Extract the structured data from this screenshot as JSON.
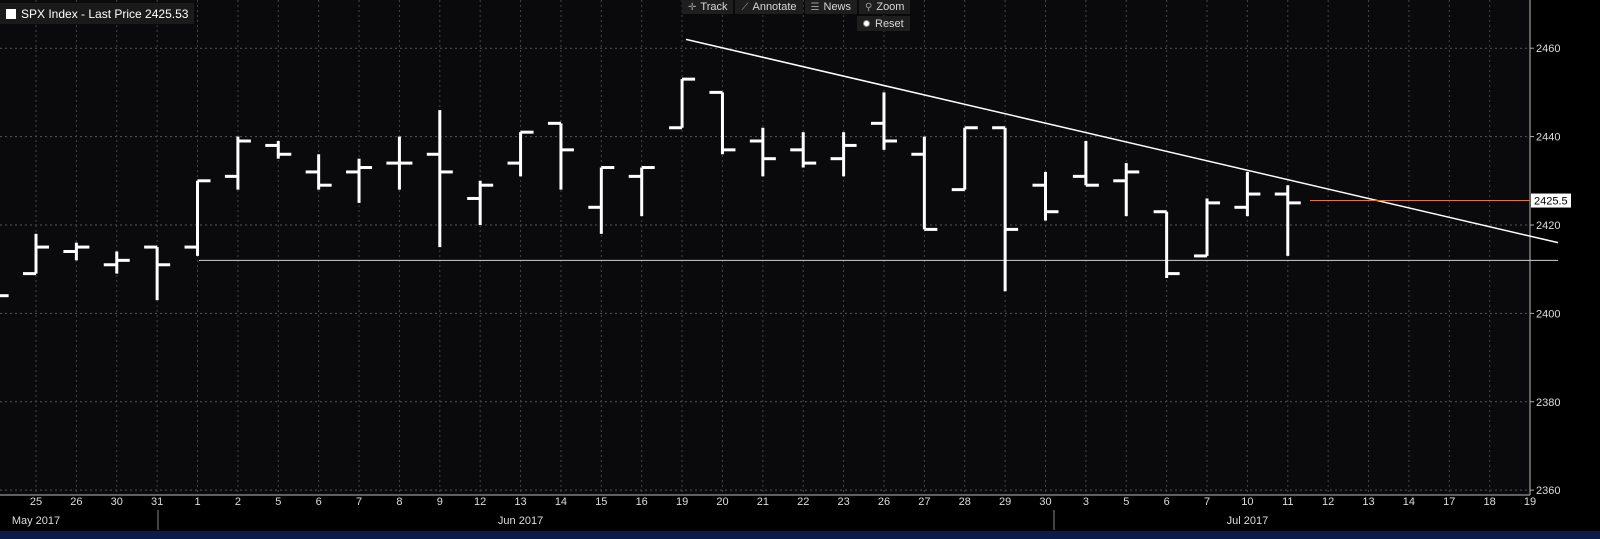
{
  "toolbar": {
    "track": "Track",
    "annotate": "Annotate",
    "news": "News",
    "zoom": "Zoom",
    "reset": "Reset"
  },
  "legend": {
    "text": "SPX Index - Last Price 2425.53"
  },
  "colors": {
    "background": "#000000",
    "bars": "#ffffff",
    "last_price_line": "#e07a2e",
    "trendline": "#ffffff"
  },
  "chart_data": {
    "type": "ohlc",
    "title": "SPX Index - Last Price 2425.53",
    "ylim": [
      2358,
      2470
    ],
    "y_ticks": [
      2360,
      2380,
      2400,
      2420,
      2440,
      2460
    ],
    "y_axis_position": "right",
    "grid": true,
    "last_price": 2425.53,
    "last_price_label": "2425.5",
    "x_tick_labels": [
      "25",
      "26",
      "30",
      "31",
      "1",
      "2",
      "5",
      "6",
      "7",
      "8",
      "9",
      "12",
      "13",
      "14",
      "15",
      "16",
      "19",
      "20",
      "21",
      "22",
      "23",
      "26",
      "27",
      "28",
      "29",
      "30",
      "3",
      "5",
      "6",
      "7",
      "10",
      "11",
      "12",
      "13",
      "14",
      "17",
      "18",
      "19"
    ],
    "month_labels": [
      {
        "label": "May 2017",
        "at": "25"
      },
      {
        "label": "Jun 2017",
        "at": "13"
      },
      {
        "label": "Jul 2017",
        "at": "10"
      }
    ],
    "bars": [
      {
        "date": "24",
        "open": 2404,
        "high": 2404,
        "low": 2404,
        "close": 2404
      },
      {
        "date": "25",
        "open": 2409,
        "high": 2418,
        "low": 2409,
        "close": 2415
      },
      {
        "date": "26",
        "open": 2414,
        "high": 2416,
        "low": 2412,
        "close": 2415
      },
      {
        "date": "30",
        "open": 2411,
        "high": 2414,
        "low": 2409,
        "close": 2412
      },
      {
        "date": "31",
        "open": 2415,
        "high": 2415,
        "low": 2403,
        "close": 2411
      },
      {
        "date": "1",
        "open": 2415,
        "high": 2430,
        "low": 2413,
        "close": 2430
      },
      {
        "date": "2",
        "open": 2431,
        "high": 2440,
        "low": 2428,
        "close": 2439
      },
      {
        "date": "5",
        "open": 2438,
        "high": 2439,
        "low": 2435,
        "close": 2436
      },
      {
        "date": "6",
        "open": 2432,
        "high": 2436,
        "low": 2428,
        "close": 2429
      },
      {
        "date": "7",
        "open": 2432,
        "high": 2435,
        "low": 2425,
        "close": 2433
      },
      {
        "date": "8",
        "open": 2434,
        "high": 2440,
        "low": 2428,
        "close": 2434
      },
      {
        "date": "9",
        "open": 2436,
        "high": 2446,
        "low": 2415,
        "close": 2432
      },
      {
        "date": "12",
        "open": 2426,
        "high": 2430,
        "low": 2420,
        "close": 2429
      },
      {
        "date": "13",
        "open": 2434,
        "high": 2441,
        "low": 2431,
        "close": 2441
      },
      {
        "date": "14",
        "open": 2443,
        "high": 2443,
        "low": 2428,
        "close": 2437
      },
      {
        "date": "15",
        "open": 2424,
        "high": 2433,
        "low": 2418,
        "close": 2433
      },
      {
        "date": "16",
        "open": 2431,
        "high": 2433,
        "low": 2422,
        "close": 2433
      },
      {
        "date": "19",
        "open": 2442,
        "high": 2453,
        "low": 2442,
        "close": 2453
      },
      {
        "date": "20",
        "open": 2450,
        "high": 2450,
        "low": 2436,
        "close": 2437
      },
      {
        "date": "21",
        "open": 2439,
        "high": 2442,
        "low": 2431,
        "close": 2435
      },
      {
        "date": "22",
        "open": 2437,
        "high": 2441,
        "low": 2433,
        "close": 2434
      },
      {
        "date": "23",
        "open": 2435,
        "high": 2441,
        "low": 2431,
        "close": 2438
      },
      {
        "date": "26",
        "open": 2443,
        "high": 2450,
        "low": 2437,
        "close": 2439
      },
      {
        "date": "27",
        "open": 2436,
        "high": 2440,
        "low": 2419,
        "close": 2419
      },
      {
        "date": "28",
        "open": 2428,
        "high": 2442,
        "low": 2428,
        "close": 2442
      },
      {
        "date": "29",
        "open": 2442,
        "high": 2442,
        "low": 2405,
        "close": 2419
      },
      {
        "date": "30",
        "open": 2429,
        "high": 2432,
        "low": 2421,
        "close": 2423
      },
      {
        "date": "3",
        "open": 2431,
        "high": 2439,
        "low": 2429,
        "close": 2429
      },
      {
        "date": "5",
        "open": 2430,
        "high": 2434,
        "low": 2422,
        "close": 2432
      },
      {
        "date": "6",
        "open": 2423,
        "high": 2423,
        "low": 2408,
        "close": 2409
      },
      {
        "date": "7",
        "open": 2413,
        "high": 2426,
        "low": 2413,
        "close": 2425
      },
      {
        "date": "10",
        "open": 2424,
        "high": 2432,
        "low": 2422,
        "close": 2427
      },
      {
        "date": "11",
        "open": 2427,
        "high": 2429,
        "low": 2413,
        "close": 2425
      }
    ],
    "trendlines": [
      {
        "name": "resistance",
        "from": {
          "date": "19",
          "value": 2462
        },
        "to": {
          "date": "19 (Jul)",
          "value": 2416
        }
      },
      {
        "name": "support",
        "from": {
          "date": "1",
          "value": 2412
        },
        "to": {
          "date": "19 (Jul)",
          "value": 2412
        }
      }
    ]
  }
}
